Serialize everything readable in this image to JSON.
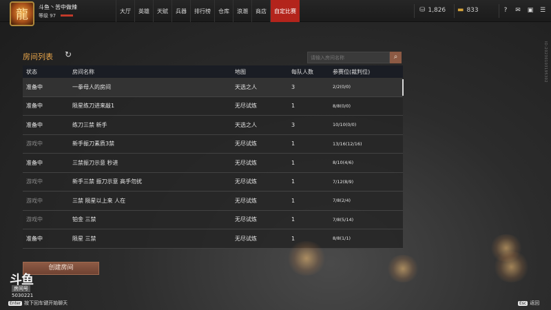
{
  "player": {
    "name": "斗鱼丶苦中做辣",
    "level": "等级 97"
  },
  "nav": {
    "items": [
      "大厅",
      "英雄",
      "天赋",
      "兵器",
      "排行榜",
      "仓库",
      "浪潮",
      "商店",
      "自定比赛"
    ],
    "active_index": 8
  },
  "currency": {
    "silver": "1,826",
    "gold": "833"
  },
  "icons": {
    "silver": "coin-stack-icon",
    "gold": "gold-bar-icon",
    "help": "help-icon",
    "mail": "mail-icon",
    "inbox": "inbox-icon",
    "menu": "menu-icon"
  },
  "panel": {
    "title": "房间列表",
    "search_placeholder": "请输入房间名称"
  },
  "table": {
    "headers": [
      "状态",
      "房间名称",
      "地图",
      "每队人数",
      "参赛位(裁判位)"
    ],
    "rows": [
      {
        "status": "准备中",
        "name": "一拳母人的房间",
        "map": "天选之人",
        "team": "3",
        "slots": "2/2(0/0)",
        "playing": false
      },
      {
        "status": "准备中",
        "name": "陨星练刀进来敲1",
        "map": "无尽试炼",
        "team": "1",
        "slots": "8/8(0/0)",
        "playing": false
      },
      {
        "status": "准备中",
        "name": "练刀三禁 新手",
        "map": "天选之人",
        "team": "3",
        "slots": "10/10(0/0)",
        "playing": false
      },
      {
        "status": "游戏中",
        "name": "新手振刀素质3禁",
        "map": "无尽试炼",
        "team": "1",
        "slots": "13/16(12/16)",
        "playing": true
      },
      {
        "status": "准备中",
        "name": "三禁振刀示意 秒进",
        "map": "无尽试炼",
        "team": "1",
        "slots": "8/10(4/6)",
        "playing": false
      },
      {
        "status": "游戏中",
        "name": "新手三禁 振刀示意 高手勿扰",
        "map": "无尽试炼",
        "team": "1",
        "slots": "7/12(8/9)",
        "playing": true
      },
      {
        "status": "游戏中",
        "name": "三禁 陨星以上来 人在",
        "map": "无尽试炼",
        "team": "1",
        "slots": "7/8(2/4)",
        "playing": true
      },
      {
        "status": "游戏中",
        "name": "铂金  三禁",
        "map": "无尽试炼",
        "team": "1",
        "slots": "7/8(5/14)",
        "playing": true
      },
      {
        "status": "准备中",
        "name": "陨星  三禁",
        "map": "无尽试炼",
        "team": "1",
        "slots": "8/8(1/1)",
        "playing": false
      }
    ]
  },
  "create_button": "创建房间",
  "stream": {
    "logo": "斗鱼",
    "room_label": "房间号",
    "room_id": "5030221"
  },
  "hints": {
    "enter_key": "Enter",
    "enter_text": "按下回车键开始聊天",
    "esc_key": "Esc",
    "esc_text": "返回"
  },
  "watermark": "ID:20230103195302"
}
